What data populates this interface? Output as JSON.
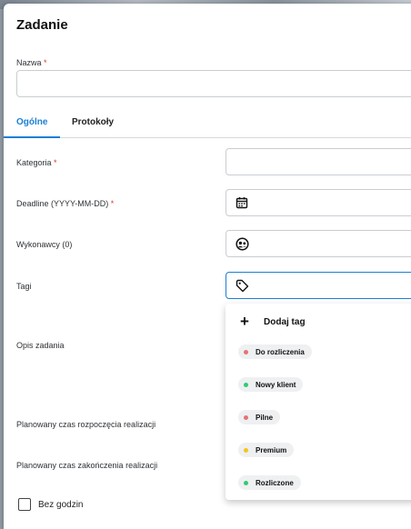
{
  "title": "Zadanie",
  "fields": {
    "name": {
      "label": "Nazwa",
      "required": "*",
      "value": ""
    },
    "category": {
      "label": "Kategoria",
      "required": "*"
    },
    "deadline": {
      "label": "Deadline (YYYY-MM-DD)",
      "required": "*"
    },
    "assignees": {
      "label": "Wykonawcy (0)"
    },
    "tags": {
      "label": "Tagi"
    },
    "description": {
      "label": "Opis zadania"
    },
    "planned_start": {
      "label": "Planowany czas rozpoczęcia realizacji"
    },
    "planned_end": {
      "label": "Planowany czas zakończenia realizacji"
    }
  },
  "tabs": [
    {
      "label": "Ogólne",
      "active": true
    },
    {
      "label": "Protokoły",
      "active": false
    }
  ],
  "tag_dropdown": {
    "add_label": "Dodaj tag",
    "tags": [
      {
        "label": "Do rozliczenia",
        "color": "#e57373"
      },
      {
        "label": "Nowy klient",
        "color": "#2ecc71"
      },
      {
        "label": "Pilne",
        "color": "#e57373"
      },
      {
        "label": "Premium",
        "color": "#f5c518"
      },
      {
        "label": "Rozliczone",
        "color": "#2ecc71"
      }
    ]
  },
  "no_hours": {
    "label": "Bez godzin",
    "checked": false
  },
  "colors": {
    "accent": "#1b7fd3",
    "required": "#d9382b"
  },
  "icons": {
    "deadline": "calendar-icon",
    "assignees": "user-group-icon",
    "tags": "tag-icon",
    "add": "plus-icon"
  }
}
